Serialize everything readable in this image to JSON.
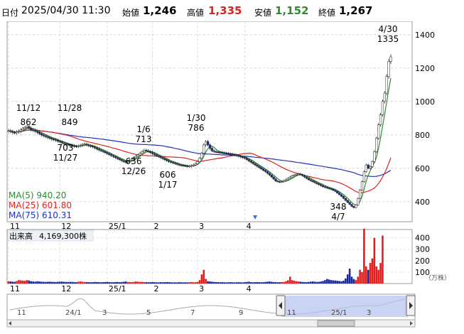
{
  "header": {
    "date_label": "日付",
    "datetime": "2025/04/30 11:30",
    "open_label": "始値",
    "open": "1,246",
    "high_label": "高値",
    "high": "1,335",
    "low_label": "安値",
    "low": "1,152",
    "close_label": "終値",
    "close": "1,267"
  },
  "colors": {
    "ma5": "#2e8b2e",
    "ma25": "#e02020",
    "ma75": "#2030c0",
    "up": "#ffffff",
    "down": "#1a2a9a",
    "vol_up": "#e02020",
    "vol_down": "#1a2a9a",
    "high_text": "#e02020",
    "low_text": "#2e8b2e"
  },
  "ma_legend": [
    {
      "label": "MA(5)",
      "value": "940.20"
    },
    {
      "label": "MA(25)",
      "value": "601.80"
    },
    {
      "label": "MA(75)",
      "value": "610.31"
    }
  ],
  "price_axis_ticks": [
    "1400",
    "1200",
    "1000",
    "800",
    "600",
    "400"
  ],
  "x_axis_labels": [
    "11",
    "12",
    "25/1",
    "2",
    "3",
    "4"
  ],
  "volume_label": "出来高",
  "volume_value": "4,169,300株",
  "volume_axis_ticks": [
    "400",
    "300",
    "200",
    "100"
  ],
  "volume_unit": "（万株）",
  "navigator_labels": [
    "11",
    "24/1",
    "3",
    "5",
    "7",
    "9",
    "11",
    "25/1",
    "3"
  ],
  "chart_data": {
    "type": "candlestick",
    "ylim": [
      280,
      1480
    ],
    "volume_ylim": [
      0,
      460
    ],
    "annotations": [
      {
        "date": "11/12",
        "value": "862",
        "kind": "high"
      },
      {
        "date": "11/28",
        "value": "849",
        "kind": "high"
      },
      {
        "date": "11/27",
        "value": "703",
        "kind": "low"
      },
      {
        "date": "1/6",
        "value": "713",
        "kind": "high"
      },
      {
        "date": "12/26",
        "value": "636",
        "kind": "low"
      },
      {
        "date": "1/17",
        "value": "606",
        "kind": "low"
      },
      {
        "date": "1/30",
        "value": "786",
        "kind": "high"
      },
      {
        "date": "4/7",
        "value": "348",
        "kind": "low"
      },
      {
        "date": "4/30",
        "value": "1335",
        "kind": "high"
      }
    ],
    "series": [
      {
        "name": "MA(5)",
        "values": []
      },
      {
        "name": "MA(25)",
        "values": []
      },
      {
        "name": "MA(75)",
        "values": []
      }
    ],
    "candles_anchor_close": [
      825,
      820,
      815,
      812,
      818,
      822,
      830,
      838,
      845,
      850,
      840,
      830,
      826,
      822,
      815,
      808,
      800,
      795,
      790,
      785,
      780,
      775,
      772,
      768,
      762,
      758,
      752,
      748,
      745,
      740,
      738,
      735,
      732,
      730,
      734,
      738,
      742,
      745,
      740,
      735,
      732,
      728,
      722,
      716,
      710,
      705,
      700,
      694,
      688,
      682,
      676,
      670,
      664,
      658,
      652,
      646,
      640,
      636,
      640,
      648,
      656,
      664,
      672,
      680,
      690,
      700,
      708,
      705,
      700,
      694,
      688,
      682,
      676,
      670,
      664,
      658,
      652,
      646,
      640,
      636,
      632,
      628,
      624,
      620,
      618,
      616,
      614,
      612,
      612,
      616,
      620,
      628,
      640,
      660,
      690,
      740,
      760,
      740,
      720,
      705,
      700,
      698,
      696,
      694,
      692,
      690,
      688,
      686,
      684,
      682,
      680,
      676,
      672,
      668,
      664,
      660,
      652,
      644,
      636,
      628,
      620,
      612,
      604,
      596,
      588,
      580,
      570,
      560,
      548,
      536,
      524,
      520,
      518,
      520,
      526,
      532,
      540,
      548,
      556,
      560,
      564,
      566,
      562,
      556,
      548,
      540,
      532,
      526,
      520,
      514,
      508,
      502,
      496,
      490,
      486,
      482,
      478,
      474,
      468,
      462,
      452,
      442,
      432,
      420,
      408,
      396,
      384,
      372,
      365,
      380,
      420,
      470,
      520,
      580,
      620,
      600,
      610,
      640,
      700,
      780,
      860,
      920,
      1000,
      1050,
      1150,
      1240,
      1267
    ],
    "volume_anchor": [
      20,
      18,
      16,
      15,
      22,
      30,
      28,
      25,
      24,
      30,
      26,
      20,
      18,
      16,
      20,
      18,
      16,
      15,
      14,
      15,
      16,
      15,
      14,
      13,
      15,
      16,
      17,
      15,
      14,
      13,
      15,
      14,
      13,
      12,
      16,
      18,
      15,
      14,
      13,
      12,
      11,
      12,
      14,
      13,
      12,
      11,
      12,
      13,
      14,
      12,
      11,
      12,
      13,
      14,
      12,
      13,
      15,
      18,
      14,
      13,
      12,
      14,
      18,
      16,
      14,
      15,
      13,
      12,
      11,
      12,
      13,
      12,
      11,
      10,
      12,
      11,
      12,
      13,
      12,
      11,
      10,
      11,
      10,
      12,
      11,
      10,
      11,
      10,
      12,
      13,
      11,
      12,
      14,
      30,
      80,
      120,
      40,
      20,
      18,
      16,
      14,
      13,
      12,
      11,
      12,
      11,
      10,
      11,
      12,
      11,
      10,
      11,
      12,
      11,
      10,
      12,
      14,
      16,
      12,
      11,
      12,
      13,
      12,
      11,
      12,
      14,
      16,
      18,
      15,
      13,
      12,
      11,
      12,
      13,
      14,
      20,
      28,
      60,
      30,
      25,
      20,
      18,
      16,
      14,
      13,
      12,
      14,
      16,
      18,
      16,
      14,
      15,
      18,
      22,
      30,
      40,
      35,
      30,
      28,
      26,
      24,
      22,
      20,
      25,
      45,
      80,
      130,
      60,
      40,
      30,
      60,
      120,
      100,
      480,
      150,
      120,
      180,
      220,
      400,
      150,
      120,
      180,
      420
    ]
  }
}
